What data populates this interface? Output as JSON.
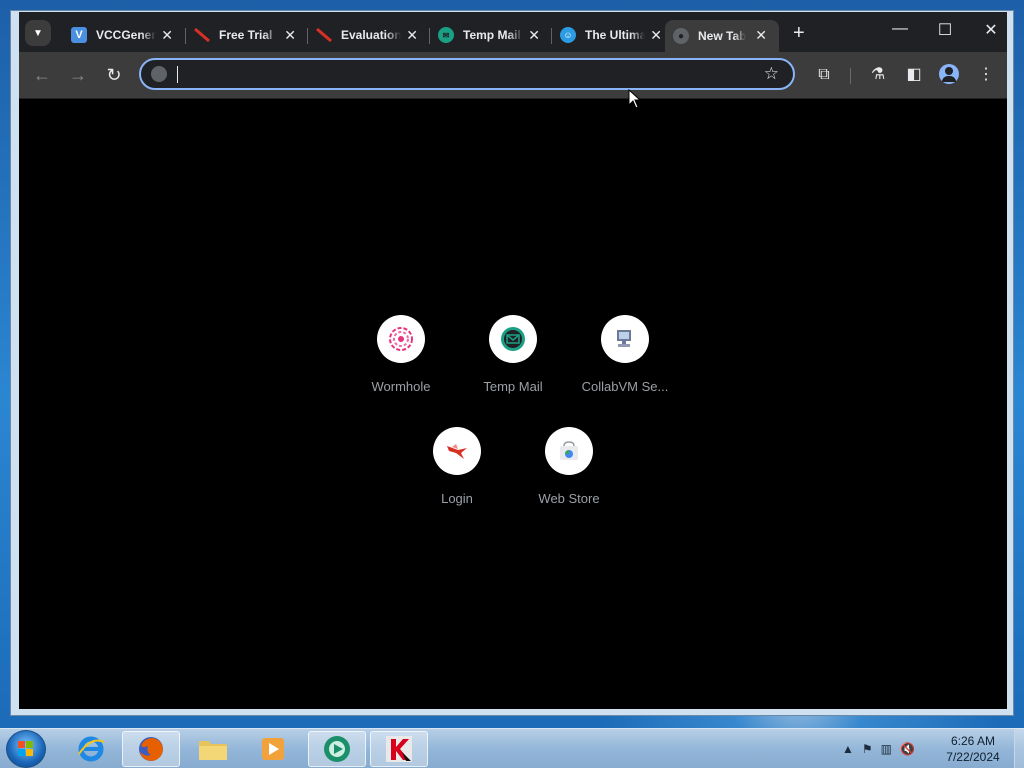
{
  "browser": {
    "tabs": [
      {
        "label": "VCCGenerator",
        "favicon": "v-logo-icon",
        "favicon_color": "#4a8fe0",
        "active": false
      },
      {
        "label": "Free Trial",
        "favicon": "red-slash-icon",
        "favicon_color": "#d93025",
        "active": false
      },
      {
        "label": "Evaluation",
        "favicon": "red-slash-icon",
        "favicon_color": "#d93025",
        "active": false
      },
      {
        "label": "Temp Mail",
        "favicon": "temp-mail-icon",
        "favicon_color": "#1aa085",
        "active": false
      },
      {
        "label": "The Ultimate",
        "favicon": "chat-icon",
        "favicon_color": "#2b9be3",
        "active": false
      },
      {
        "label": "New Tab",
        "favicon": "globe-icon",
        "favicon_color": "#9aa0a6",
        "active": true
      }
    ],
    "window_controls": {
      "minimize": "—",
      "maximize": "☐",
      "close": "✕"
    },
    "omnibox": {
      "value": "",
      "placeholder": ""
    },
    "accent_color": "#8ab4f8"
  },
  "new_tab": {
    "shortcuts": [
      {
        "name": "Wormhole",
        "icon": "wormhole-icon",
        "color": "#e8337f"
      },
      {
        "name": "Temp Mail",
        "icon": "temp-mail-icon",
        "color": "#1aa085"
      },
      {
        "name": "CollabVM Se...",
        "icon": "collabvm-icon",
        "color": "#6c7a99"
      },
      {
        "name": "Login",
        "icon": "bird-icon",
        "color": "#d93025"
      },
      {
        "name": "Web Store",
        "icon": "web-store-icon",
        "color": "#4285f4"
      }
    ]
  },
  "taskbar": {
    "items": [
      {
        "name": "internet-explorer",
        "open": false
      },
      {
        "name": "firefox",
        "open": true
      },
      {
        "name": "file-explorer",
        "open": false
      },
      {
        "name": "media-player",
        "open": false
      },
      {
        "name": "chrome-app",
        "open": true
      },
      {
        "name": "kaspersky",
        "open": true
      }
    ],
    "clock": {
      "time": "6:26 AM",
      "date": "7/22/2024"
    }
  }
}
